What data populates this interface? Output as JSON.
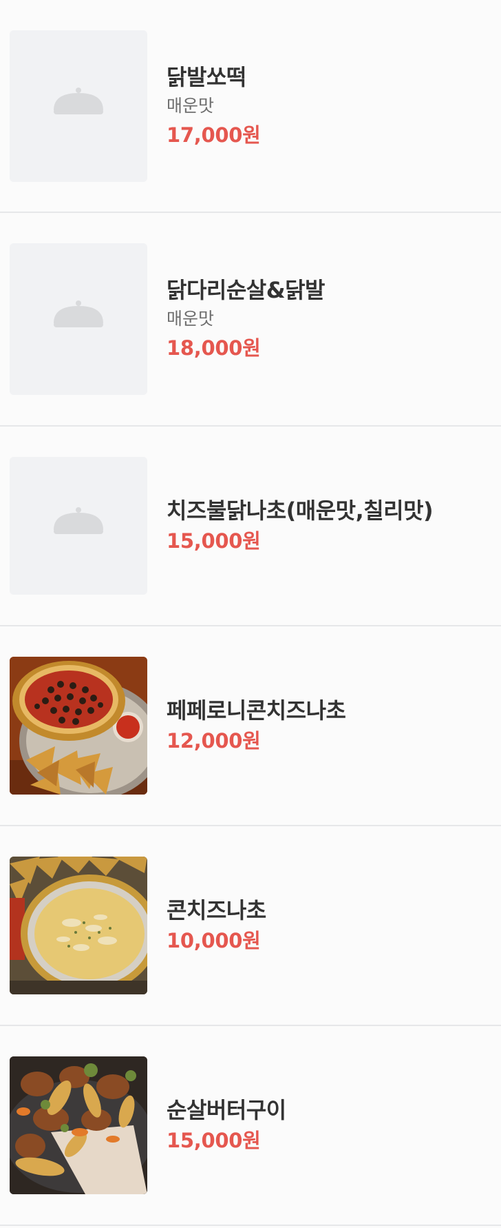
{
  "theme": {
    "price_color": "#e5574f",
    "placeholder_bg": "#f1f2f4",
    "placeholder_icon_color": "#d9dadc"
  },
  "menu": {
    "items": [
      {
        "name": "닭발쏘떡",
        "description": "매운맛",
        "price": "17,000원",
        "thumbnail": "food-placeholder-icon"
      },
      {
        "name": "닭다리순살&닭발",
        "description": "매운맛",
        "price": "18,000원",
        "thumbnail": "food-placeholder-icon"
      },
      {
        "name": "치즈불닭나초(매운맛,칠리맛)",
        "price": "15,000원",
        "thumbnail": "food-placeholder-icon"
      },
      {
        "name": "페페로니콘치즈나초",
        "price": "12,000원",
        "thumbnail": "pepperoni-nachos-photo"
      },
      {
        "name": "콘치즈나초",
        "price": "10,000원",
        "thumbnail": "corn-cheese-nachos-photo"
      },
      {
        "name": "순살버터구이",
        "price": "15,000원",
        "thumbnail": "butter-grilled-chicken-photo"
      }
    ]
  }
}
